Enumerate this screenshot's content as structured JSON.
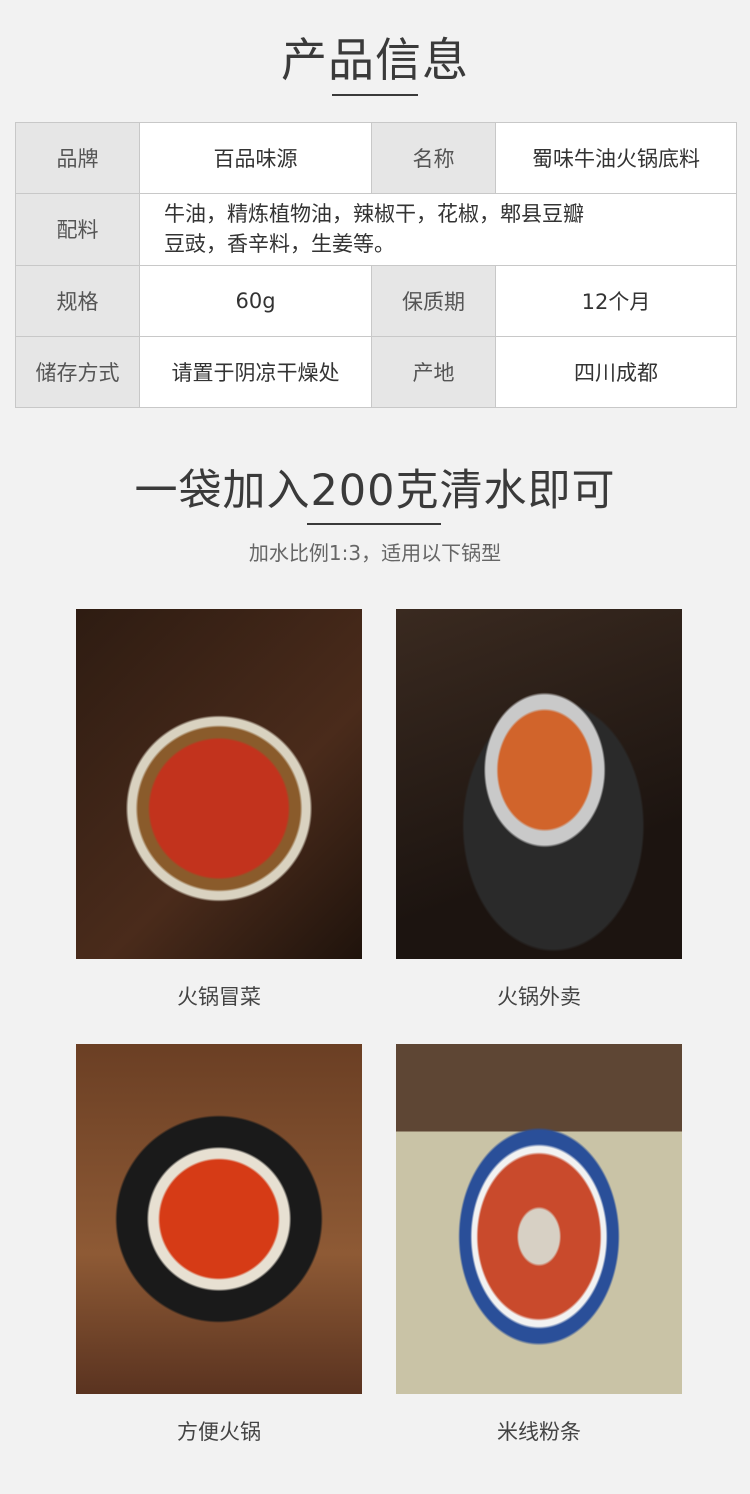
{
  "product_info": {
    "title": "产品信息",
    "rows": [
      [
        {
          "label": "品牌",
          "value": "百品味源"
        },
        {
          "label": "名称",
          "value": "蜀味牛油火锅底料"
        }
      ],
      [
        {
          "label": "配料",
          "value_lines": [
            "牛油，精炼植物油，辣椒干，花椒，郫县豆瓣",
            "豆豉，香辛料，生姜等。"
          ]
        }
      ],
      [
        {
          "label": "规格",
          "value": "60g"
        },
        {
          "label": "保质期",
          "value": "12个月"
        }
      ],
      [
        {
          "label": "储存方式",
          "value": "请置于阴凉干燥处"
        },
        {
          "label": "产地",
          "value": "四川成都"
        }
      ]
    ]
  },
  "usage": {
    "title": "一袋加入200克清水即可",
    "subtitle": "加水比例1:3，适用以下锅型",
    "items": [
      {
        "caption": "火锅冒菜"
      },
      {
        "caption": "火锅外卖"
      },
      {
        "caption": "方便火锅"
      },
      {
        "caption": "米线粉条"
      }
    ]
  }
}
